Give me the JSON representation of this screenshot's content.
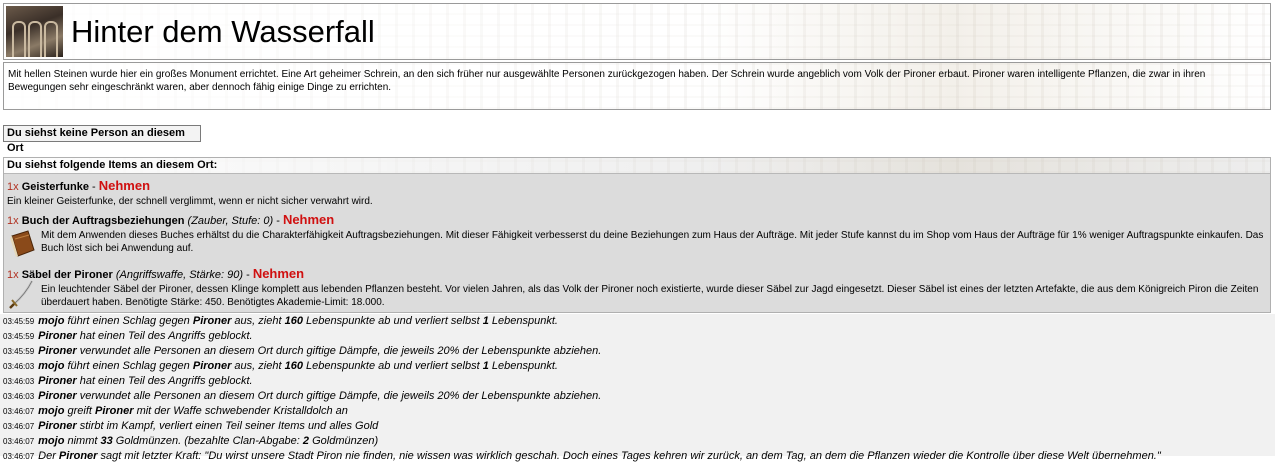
{
  "header": {
    "title": "Hinter dem Wasserfall",
    "logo_icon": "ruins-logo-icon"
  },
  "description": "Mit hellen Steinen wurde hier ein großes Monument errichtet. Eine Art geheimer Schrein, an den sich früher nur ausgewählte Personen zurückgezogen haben. Der Schrein wurde angeblich vom Volk der Pironer erbaut. Pironer waren intelligente Pflanzen, die zwar in ihren Bewegungen sehr eingeschränkt waren, aber dennoch fähig einige Dinge zu errichten.",
  "people": {
    "label": "Du siehst keine Person an diesem Ort"
  },
  "items_panel": {
    "header": "Du siehst folgende Items an diesem Ort:",
    "take_label": "Nehmen",
    "items": [
      {
        "qty": "1x",
        "name": "Geisterfunke",
        "attrs": "",
        "separator": "-",
        "description": "Ein kleiner Geisterfunke, der schnell verglimmt, wenn er nicht sicher verwahrt wird.",
        "icon": ""
      },
      {
        "qty": "1x",
        "name": "Buch der Auftragsbeziehungen",
        "attrs": "(Zauber, Stufe: 0)",
        "separator": "-",
        "description": "Mit dem Anwenden dieses Buches erhältst du die Charakterfähigkeit Auftragsbeziehungen. Mit dieser Fähigkeit verbesserst du deine Beziehungen zum Haus der Aufträge. Mit jeder Stufe kannst du im Shop vom Haus der Aufträge für 1% weniger Auftragspunkte einkaufen. Das Buch löst sich bei Anwendung auf.",
        "icon": "book-icon"
      },
      {
        "qty": "1x",
        "name": "Säbel der Pironer",
        "attrs": "(Angriffswaffe, Stärke: 90)",
        "separator": "-",
        "description": "Ein leuchtender Säbel der Pironer, dessen Klinge komplett aus lebenden Pflanzen besteht. Vor vielen Jahren, als das Volk der Pironer noch existierte, wurde dieser Säbel zur Jagd eingesetzt. Dieser Säbel ist eines der letzten Artefakte, die aus dem Königreich Piron die Zeiten überdauert haben. Benötigte Stärke: 450. Benötigtes Akademie-Limit: 18.000.",
        "icon": "sabre-icon"
      }
    ]
  },
  "log": [
    {
      "t": "03:45:59",
      "parts": [
        [
          "b",
          "mojo"
        ],
        [
          "n",
          " führt einen Schlag gegen "
        ],
        [
          "b",
          "Pironer"
        ],
        [
          "n",
          " aus, zieht "
        ],
        [
          "b",
          "160"
        ],
        [
          "n",
          " Lebenspunkte ab und verliert selbst "
        ],
        [
          "b",
          "1"
        ],
        [
          "n",
          " Lebenspunkt."
        ]
      ]
    },
    {
      "t": "03:45:59",
      "parts": [
        [
          "b",
          "Pironer"
        ],
        [
          "n",
          " hat einen Teil des Angriffs geblockt."
        ]
      ]
    },
    {
      "t": "03:45:59",
      "parts": [
        [
          "b",
          "Pironer"
        ],
        [
          "n",
          " verwundet alle Personen an diesem Ort durch giftige Dämpfe, die jeweils 20% der Lebenspunkte abziehen."
        ]
      ]
    },
    {
      "t": "03:46:03",
      "parts": [
        [
          "b",
          "mojo"
        ],
        [
          "n",
          " führt einen Schlag gegen "
        ],
        [
          "b",
          "Pironer"
        ],
        [
          "n",
          " aus, zieht "
        ],
        [
          "b",
          "160"
        ],
        [
          "n",
          " Lebenspunkte ab und verliert selbst "
        ],
        [
          "b",
          "1"
        ],
        [
          "n",
          " Lebenspunkt."
        ]
      ]
    },
    {
      "t": "03:46:03",
      "parts": [
        [
          "b",
          "Pironer"
        ],
        [
          "n",
          " hat einen Teil des Angriffs geblockt."
        ]
      ]
    },
    {
      "t": "03:46:03",
      "parts": [
        [
          "b",
          "Pironer"
        ],
        [
          "n",
          " verwundet alle Personen an diesem Ort durch giftige Dämpfe, die jeweils 20% der Lebenspunkte abziehen."
        ]
      ]
    },
    {
      "t": "03:46:07",
      "parts": [
        [
          "b",
          "mojo"
        ],
        [
          "n",
          " greift "
        ],
        [
          "b",
          "Pironer"
        ],
        [
          "n",
          " mit der Waffe schwebender Kristalldolch an"
        ]
      ]
    },
    {
      "t": "03:46:07",
      "parts": [
        [
          "b",
          "Pironer"
        ],
        [
          "n",
          " stirbt im Kampf, verliert einen Teil seiner Items und alles Gold"
        ]
      ]
    },
    {
      "t": "03:46:07",
      "parts": [
        [
          "b",
          "mojo"
        ],
        [
          "n",
          " nimmt "
        ],
        [
          "b",
          "33"
        ],
        [
          "n",
          " Goldmünzen. (bezahlte Clan-Abgabe: "
        ],
        [
          "b",
          "2"
        ],
        [
          "n",
          " Goldmünzen)"
        ]
      ]
    },
    {
      "t": "03:46:07",
      "parts": [
        [
          "n",
          "Der "
        ],
        [
          "b",
          "Pironer"
        ],
        [
          "n",
          " sagt mit letzter Kraft: \"Du wirst unsere Stadt Piron nie finden, nie wissen was wirklich geschah. Doch eines Tages kehren wir zurück, an dem Tag, an dem die Pflanzen wieder die Kontrolle über diese Welt übernehmen.\""
        ]
      ]
    }
  ],
  "colors": {
    "item_panel_bg": "#dcdcdc",
    "take_link": "#d01010",
    "quantity": "#b03020",
    "log_bg": "#f1f1f1"
  }
}
